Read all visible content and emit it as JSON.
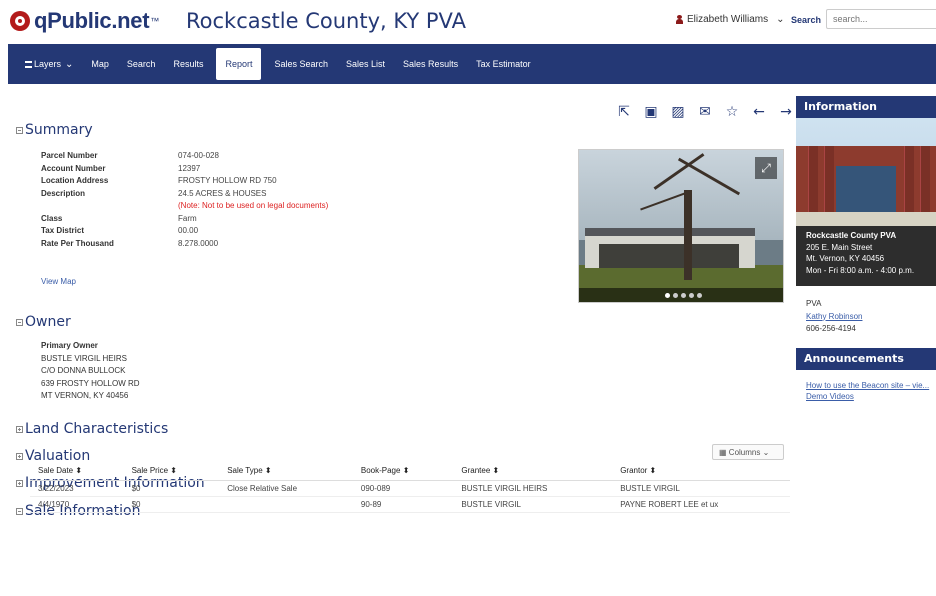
{
  "header": {
    "logo": "qPublic.net",
    "logo_tm": "™",
    "site_title": "Rockcastle County, KY PVA",
    "user_name": "Elizabeth Williams",
    "search_label": "Search",
    "search_placeholder": "search..."
  },
  "nav": {
    "items": [
      "Layers",
      "Map",
      "Search",
      "Results",
      "Report",
      "Sales Search",
      "Sales List",
      "Sales Results",
      "Tax Estimator"
    ],
    "active": "Report"
  },
  "summary": {
    "title": "Summary",
    "fields": [
      {
        "label": "Parcel Number",
        "value": "074-00-028"
      },
      {
        "label": "Account Number",
        "value": "12397"
      },
      {
        "label": "Location Address",
        "value": "FROSTY HOLLOW RD 750"
      },
      {
        "label": "Description",
        "value": "24.5 ACRES & HOUSES"
      },
      {
        "label": "",
        "value": "(Note: Not to be used on legal documents)"
      },
      {
        "label": "Class",
        "value": "Farm"
      },
      {
        "label": "Tax District",
        "value": "00.00"
      },
      {
        "label": "Rate Per Thousand",
        "value": "8.278.0000"
      }
    ],
    "view_map": "View Map"
  },
  "owner": {
    "title": "Owner",
    "label": "Primary Owner",
    "lines": [
      "BUSTLE VIRGIL HEIRS",
      "C/O DONNA BULLOCK",
      "639 FROSTY HOLLOW RD",
      "MT VERNON, KY 40456"
    ]
  },
  "sections": {
    "land": "Land Characteristics",
    "valuation": "Valuation",
    "improvement": "Improvement Information",
    "sale": "Sale Information"
  },
  "sale_table": {
    "columns_button": "Columns",
    "headers": [
      "Sale Date",
      "Sale Price",
      "Sale Type",
      "Book-Page",
      "Grantee",
      "Grantor"
    ],
    "rows": [
      [
        "3/22/2023",
        "$0",
        "Close Relative Sale",
        "090-089",
        "BUSTLE VIRGIL HEIRS",
        "BUSTLE VIRGIL"
      ],
      [
        "4/4/1970",
        "$0",
        "",
        "90-89",
        "BUSTLE VIRGIL",
        "PAYNE ROBERT LEE et ux"
      ]
    ]
  },
  "sidebar": {
    "info_title": "Information",
    "office_name": "Rockcastle County PVA",
    "office_addr1": "205 E. Main Street",
    "office_addr2": "Mt. Vernon, KY 40456",
    "office_hours": "Mon - Fri 8:00 a.m. - 4:00 p.m.",
    "pva_label": "PVA",
    "pva_name": "Kathy Robinson",
    "pva_phone": "606-256-4194",
    "announcements_title": "Announcements",
    "announcement_link1": "How to use the Beacon site – vie...",
    "announcement_link2": "Demo Videos"
  }
}
